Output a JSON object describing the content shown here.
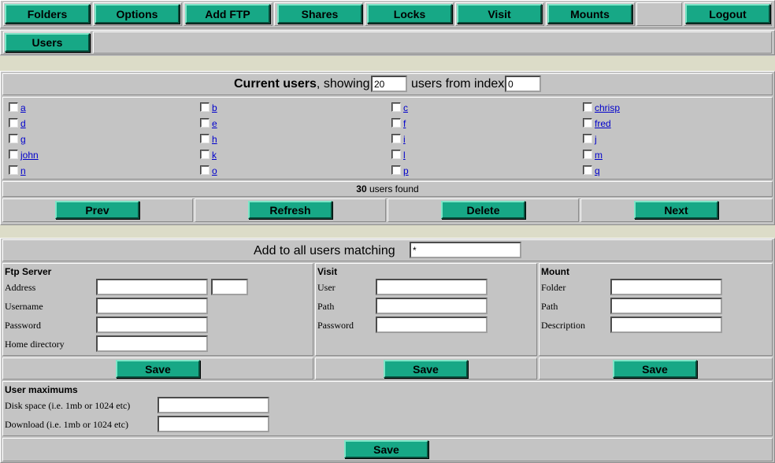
{
  "topnav": [
    "Folders",
    "Options",
    "Add FTP",
    "Shares",
    "Locks",
    "Visit",
    "Mounts"
  ],
  "logout_label": "Logout",
  "subnav": {
    "users_label": "Users"
  },
  "current_users": {
    "title_bold": "Current users",
    "title_mid": ", showing",
    "showing_value": "20",
    "title_end": "users from index",
    "index_value": "0",
    "columns": [
      [
        "a",
        "d",
        "g",
        "john",
        "n"
      ],
      [
        "b",
        "e",
        "h",
        "k",
        "o"
      ],
      [
        "c",
        "f",
        "i",
        "l",
        "p"
      ],
      [
        "chrisp",
        "fred",
        "j",
        "m",
        "q"
      ]
    ],
    "found_count": "30",
    "found_text": "users found"
  },
  "pager": {
    "prev": "Prev",
    "refresh": "Refresh",
    "delete": "Delete",
    "next": "Next"
  },
  "add_all": {
    "title": "Add to all users matching",
    "pattern_value": "*"
  },
  "ftp": {
    "heading": "Ftp Server",
    "address": "Address",
    "username": "Username",
    "password": "Password",
    "home": "Home directory",
    "save": "Save"
  },
  "visit": {
    "heading": "Visit",
    "user": "User",
    "path": "Path",
    "password": "Password",
    "save": "Save"
  },
  "mount": {
    "heading": "Mount",
    "folder": "Folder",
    "path": "Path",
    "description": "Description",
    "save": "Save"
  },
  "maximums": {
    "heading": "User maximums",
    "disk": "Disk space (i.e. 1mb or 1024 etc)",
    "download": "Download (i.e. 1mb or 1024 etc)",
    "save": "Save"
  },
  "colors": {
    "button": "#17a886",
    "panel": "#c0c0c0",
    "band": "#dcdcc8",
    "link": "#0000cc"
  }
}
